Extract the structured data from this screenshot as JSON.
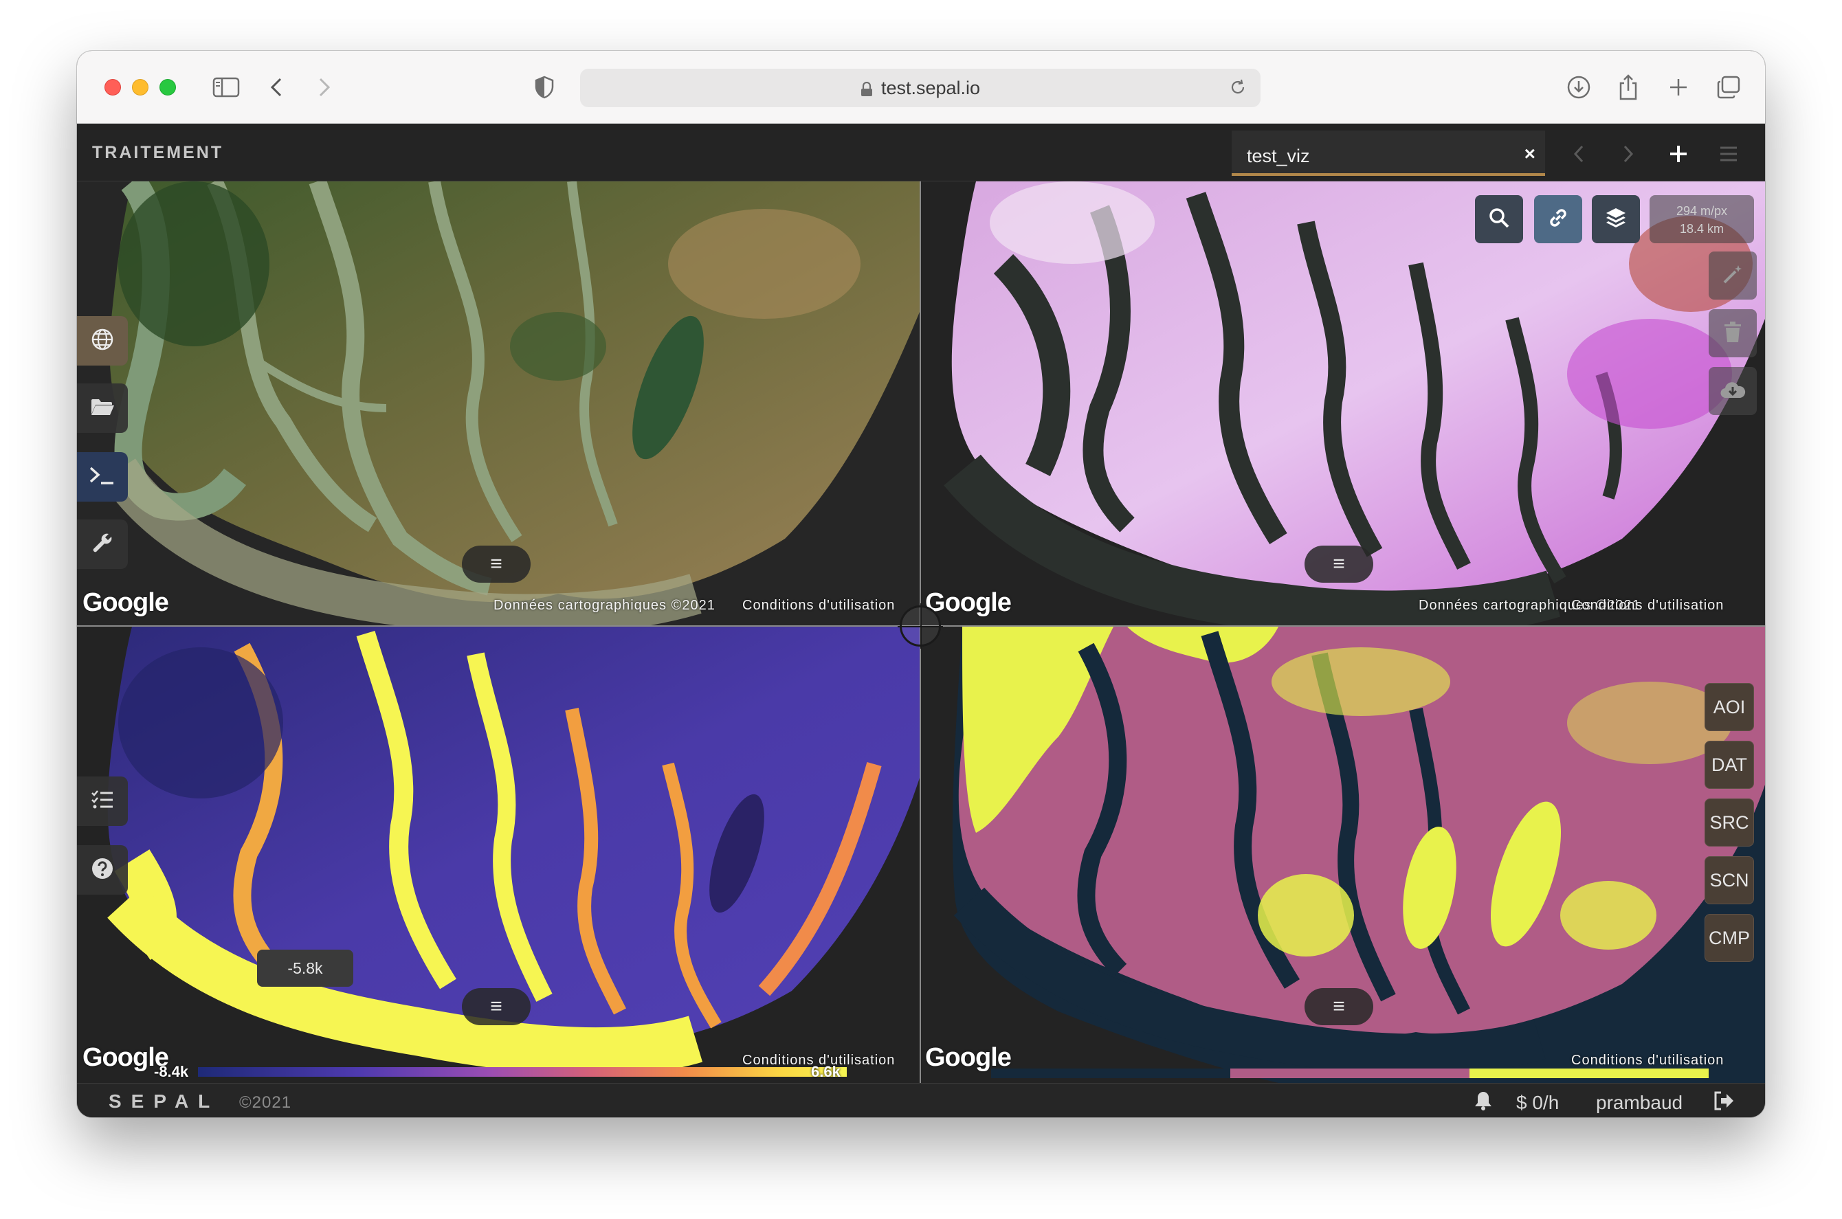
{
  "browser": {
    "url": "test.sepal.io"
  },
  "app": {
    "title": "TRAITEMENT",
    "tab_label": "test_viz",
    "tab_close": "×"
  },
  "maps": {
    "google_label": "Google",
    "map_data": "Données cartographiques ©2021",
    "terms": "Conditions d'utilisation",
    "scale_line1": "294 m/px",
    "scale_line2": "18.4 km",
    "menu_glyph": "≡"
  },
  "recipe_buttons": [
    "AOI",
    "DAT",
    "SRC",
    "SCN",
    "CMP"
  ],
  "legend": {
    "min_label": "-8.4k",
    "max_label": "6.6k",
    "tooltip": "-5.8k",
    "ramp_colors": [
      "#1e2a78",
      "#4f3ab0",
      "#9b4db3",
      "#d4607a",
      "#f18b4a",
      "#fbd743",
      "#f6f552"
    ],
    "categories": [
      "#15293b",
      "#b05c86",
      "#e8f24c"
    ]
  },
  "footer": {
    "brand": "SEPAL",
    "copyright": "©2021",
    "cost": "$ 0/h",
    "username": "prambaud"
  },
  "icons": {
    "sidebar": [
      "globe-icon",
      "folder-icon",
      "terminal-icon",
      "wrench-icon"
    ],
    "sidebar_lower": [
      "checklist-icon",
      "help-icon"
    ],
    "map_controls": [
      "search-icon",
      "link-icon",
      "layers-icon"
    ],
    "tools": [
      "magic-wand-icon",
      "trash-icon",
      "cloud-download-icon"
    ]
  }
}
